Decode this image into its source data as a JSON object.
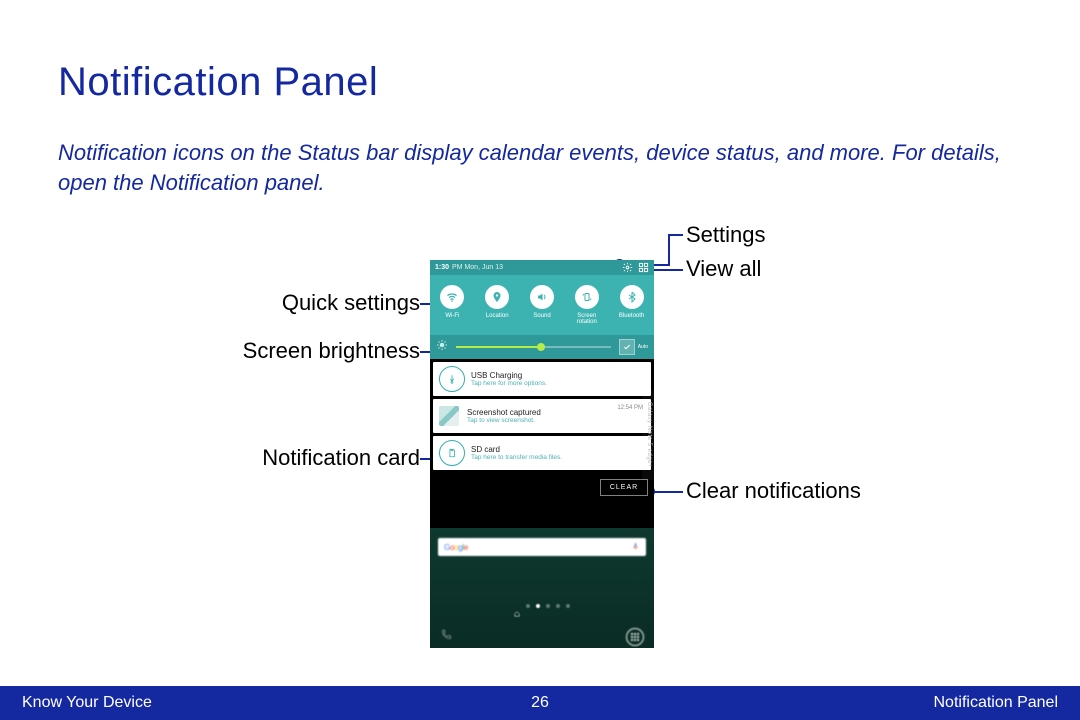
{
  "page": {
    "title": "Notification Panel",
    "intro": "Notification icons on the Status bar display calendar events, device status, and more. For details, open the Notification panel."
  },
  "callouts": {
    "quick_settings": "Quick settings",
    "screen_brightness": "Screen brightness",
    "notification_card": "Notification card",
    "settings": "Settings",
    "view_all": "View all",
    "clear_notifications": "Clear notifications"
  },
  "statusbar": {
    "time": "1:30",
    "meridiem_date": "PM Mon, Jun 13"
  },
  "quick_settings": [
    {
      "icon": "wifi",
      "label": "Wi-Fi"
    },
    {
      "icon": "location",
      "label": "Location"
    },
    {
      "icon": "sound",
      "label": "Sound"
    },
    {
      "icon": "rotation",
      "label": "Screen\nrotation"
    },
    {
      "icon": "bluetooth",
      "label": "Bluetooth"
    }
  ],
  "brightness": {
    "auto_label": "Auto"
  },
  "notifications": [
    {
      "kind": "icon",
      "icon": "usb",
      "title": "USB Charging",
      "sub": "Tap here for more options."
    },
    {
      "kind": "thumb",
      "title": "Screenshot captured",
      "sub": "Tap to view screenshot.",
      "time": "12:54 PM"
    },
    {
      "kind": "icon",
      "icon": "sd",
      "title": "SD card",
      "sub": "Tap here to transfer media files."
    }
  ],
  "clear_label": "CLEAR",
  "side_label": "Galaxy Note 5 edge+",
  "footer": {
    "left": "Know Your Device",
    "page": "26",
    "right": "Notification Panel"
  }
}
